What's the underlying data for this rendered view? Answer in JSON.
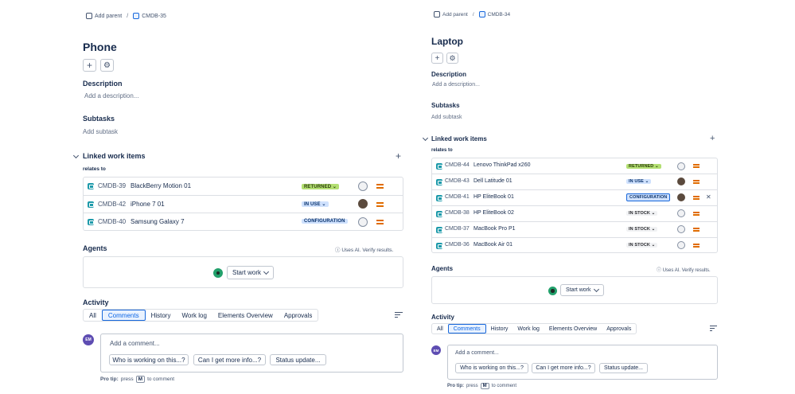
{
  "left": {
    "breadcrumb": {
      "parent": "Add parent",
      "sep": "/",
      "key": "CMDB-35"
    },
    "title": "Phone",
    "add_icon": "+",
    "settings_icon": "⚙",
    "description": {
      "heading": "Description",
      "placeholder": "Add a description..."
    },
    "subtasks": {
      "heading": "Subtasks",
      "add": "Add subtask"
    },
    "linked": {
      "heading": "Linked work items",
      "plus": "+",
      "relation": "relates to",
      "items": [
        {
          "key": "CMDB-39",
          "summary": "BlackBerry Motion 01",
          "status": "RETURNED",
          "status_type": "returned",
          "avatar": "empty"
        },
        {
          "key": "CMDB-42",
          "summary": "iPhone 7 01",
          "status": "IN USE",
          "status_type": "inuse",
          "avatar": "photo"
        },
        {
          "key": "CMDB-40",
          "summary": "Samsung Galaxy 7",
          "status": "CONFIGURATION",
          "status_type": "config",
          "avatar": "empty"
        }
      ]
    },
    "agents": {
      "heading": "Agents",
      "ai_note": "Uses AI. Verify results.",
      "start": "Start work"
    },
    "activity": {
      "heading": "Activity",
      "tabs": [
        "All",
        "Comments",
        "History",
        "Work log",
        "Elements Overview",
        "Approvals"
      ],
      "active": 1,
      "avatar": "EM",
      "placeholder": "Add a comment...",
      "suggestions": [
        "Who is working on this...?",
        "Can I get more info...?",
        "Status update..."
      ],
      "tip_label": "Pro tip:",
      "tip_press": "press",
      "tip_key": "M",
      "tip_end": "to comment"
    }
  },
  "right": {
    "breadcrumb": {
      "parent": "Add parent",
      "sep": "/",
      "key": "CMDB-34"
    },
    "title": "Laptop",
    "add_icon": "+",
    "settings_icon": "⚙",
    "description": {
      "heading": "Description",
      "placeholder": "Add a description..."
    },
    "subtasks": {
      "heading": "Subtasks",
      "add": "Add subtask"
    },
    "linked": {
      "heading": "Linked work items",
      "plus": "+",
      "relation": "relates to",
      "remove_icon": "✕",
      "items": [
        {
          "key": "CMDB-44",
          "summary": "Lenovo ThinkPad x260",
          "status": "RETURNED",
          "status_type": "returned",
          "avatar": "empty"
        },
        {
          "key": "CMDB-43",
          "summary": "Dell Latitude 01",
          "status": "IN USE",
          "status_type": "inuse",
          "avatar": "photo"
        },
        {
          "key": "CMDB-41",
          "summary": "HP EliteBook 01",
          "status": "CONFIGURATION",
          "status_type": "config",
          "avatar": "photo"
        },
        {
          "key": "CMDB-38",
          "summary": "HP EliteBook 02",
          "status": "IN STOCK",
          "status_type": "stock",
          "avatar": "empty"
        },
        {
          "key": "CMDB-37",
          "summary": "MacBook Pro P1",
          "status": "IN STOCK",
          "status_type": "stock",
          "avatar": "empty"
        },
        {
          "key": "CMDB-36",
          "summary": "MacBook Air 01",
          "status": "IN STOCK",
          "status_type": "stock",
          "avatar": "empty"
        }
      ]
    },
    "agents": {
      "heading": "Agents",
      "ai_note": "Uses AI. Verify results.",
      "start": "Start work"
    },
    "activity": {
      "heading": "Activity",
      "tabs": [
        "All",
        "Comments",
        "History",
        "Work log",
        "Elements Overview",
        "Approvals"
      ],
      "active": 1,
      "avatar": "EM",
      "placeholder": "Add a comment...",
      "suggestions": [
        "Who is working on this...?",
        "Can I get more info...?",
        "Status update..."
      ],
      "tip_label": "Pro tip:",
      "tip_press": "press",
      "tip_key": "M",
      "tip_end": "to comment"
    }
  }
}
